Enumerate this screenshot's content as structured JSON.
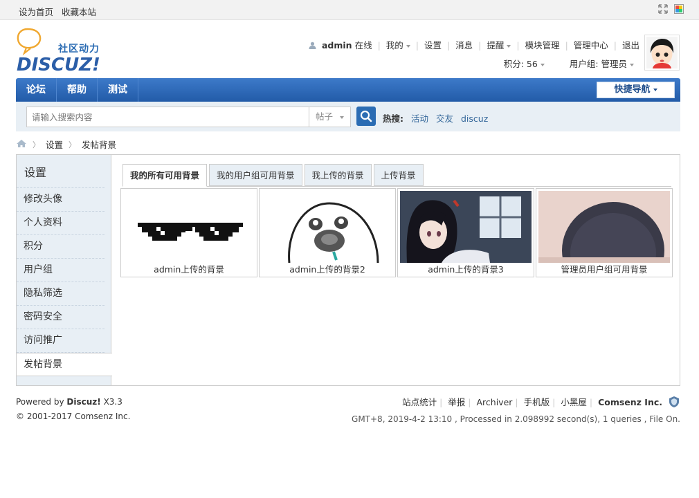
{
  "topbar": {
    "links": [
      "设为首页",
      "收藏本站"
    ]
  },
  "logo": {
    "cn": "社区动力",
    "en": "DISCUZ!"
  },
  "user": {
    "name": "admin",
    "status": "在线",
    "menu": [
      "我的",
      "设置",
      "消息",
      "提醒",
      "模块管理",
      "管理中心",
      "退出"
    ],
    "credits_label": "积分: 56",
    "group_label": "用户组: 管理员"
  },
  "nav": {
    "items": [
      "论坛",
      "帮助",
      "测试"
    ],
    "quick": "快捷导航"
  },
  "search": {
    "placeholder": "请输入搜索内容",
    "type": "帖子",
    "hot_label": "热搜:",
    "hot": [
      "活动",
      "交友",
      "discuz"
    ]
  },
  "breadcrumb": [
    "设置",
    "发帖背景"
  ],
  "sidebar": {
    "title": "设置",
    "items": [
      "修改头像",
      "个人资料",
      "积分",
      "用户组",
      "隐私筛选",
      "密码安全",
      "访问推广",
      "发帖背景"
    ],
    "active": "发帖背景"
  },
  "tabs": [
    "我的所有可用背景",
    "我的用户组可用背景",
    "我上传的背景",
    "上传背景"
  ],
  "backgrounds": [
    {
      "caption": "admin上传的背景",
      "pic": "pixel-sunglasses"
    },
    {
      "caption": "admin上传的背景2",
      "pic": "meme-face"
    },
    {
      "caption": "admin上传的背景3",
      "pic": "anime-girl"
    },
    {
      "caption": "管理员用户组可用背景",
      "pic": "dark-plate"
    }
  ],
  "footer": {
    "powered": "Powered by",
    "brand": "Discuz!",
    "version": "X3.3",
    "copyright": "© 2001-2017",
    "company": "Comsenz Inc.",
    "links": [
      "站点统计",
      "举报",
      "Archiver",
      "手机版",
      "小黑屋"
    ],
    "corp": "Comsenz Inc.",
    "status": "GMT+8, 2019-4-2 13:10 , Processed in 2.098992 second(s), 1 queries , File On."
  },
  "colors": {
    "nav": "#2b66b2",
    "link": "#336699",
    "sidebar": "#e8eff5"
  }
}
